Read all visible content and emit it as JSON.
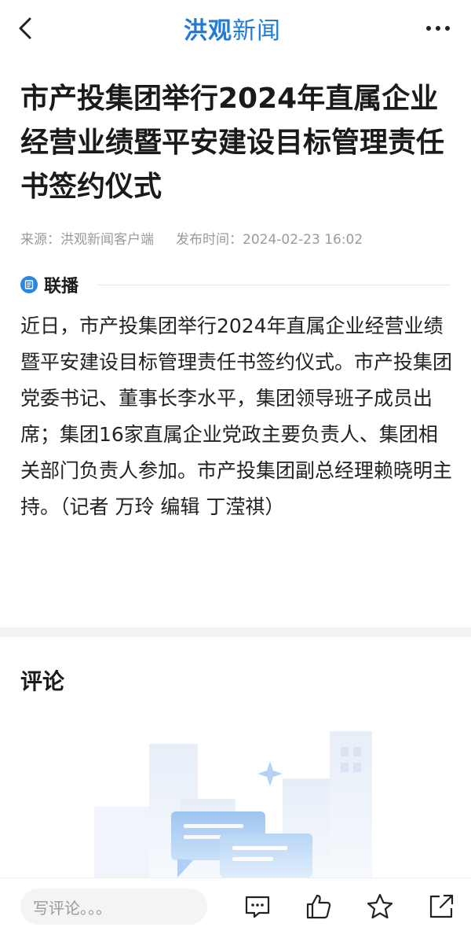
{
  "header": {
    "brand_part1": "洪观",
    "brand_part2": "新闻",
    "back_icon": "chevron-left-icon",
    "more_icon": "more-dots-icon"
  },
  "article": {
    "title": "市产投集团举行2024年直属企业经营业绩暨平安建设目标管理责任书签约仪式",
    "source": "来源：洪观新闻客户端",
    "published": "发布时间：2024-02-23 16:02",
    "section_label": "联播",
    "body": "近日，市产投集团举行2024年直属企业经营业绩暨平安建设目标管理责任书签约仪式。市产投集团党委书记、董事长李水平，集团领导班子成员出席；集团16家直属企业党政主要负责人、集团相关部门负责人参加。市产投集团副总经理赖晓明主持。（记者 万玲 编辑 丁滢祺）"
  },
  "comments": {
    "title": "评论"
  },
  "bottom_bar": {
    "comment_placeholder": "写评论。。。",
    "icons": [
      "comment-icon",
      "thumb-up-icon",
      "star-icon",
      "share-icon"
    ]
  },
  "colors": {
    "brand": "#1e7bd7",
    "section_icon": "#2a86e0",
    "meta_text": "#9a9a9a"
  }
}
